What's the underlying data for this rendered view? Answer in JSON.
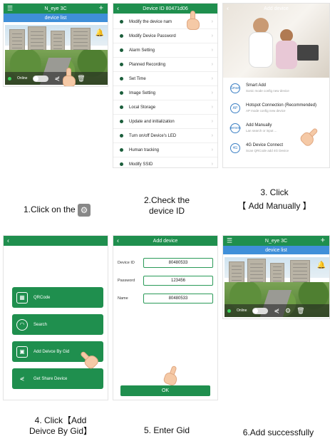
{
  "p1": {
    "title": "N_eye 3C",
    "subtitle": "device list",
    "status": "Online"
  },
  "p2": {
    "title": "Device ID 80471d06",
    "items": [
      "Modify the device nam",
      "Modify Device Password",
      "Alarm Setting",
      "Planned Recording",
      "Set Time",
      "Image Setting",
      "Local Storage",
      "Update and initialization",
      "Turn on/off Device's LED",
      "Human tracking",
      "Modify SSID"
    ]
  },
  "p3": {
    "title": "Add device",
    "options": [
      {
        "title": "Smart Add",
        "desc": "Sonic mode config new device",
        "icon": "Smart"
      },
      {
        "title": "Hotspot Connection (Recommended)",
        "desc": "AP mode config new device",
        "icon": "AP"
      },
      {
        "title": "Add Manually",
        "desc": "Lan search or input ...",
        "icon": "person"
      },
      {
        "title": "4G Device Connect",
        "desc": "Scan QRCode add 4G Device",
        "icon": "4G"
      }
    ]
  },
  "p4": {
    "buttons": [
      "QRCode",
      "Search",
      "Add Deivce By Gid",
      "Get Share Device"
    ]
  },
  "p5": {
    "title": "Add device",
    "fields": [
      {
        "label": "Device ID",
        "value": "80480533"
      },
      {
        "label": "Password",
        "value": "123456"
      },
      {
        "label": "Name",
        "value": "80480533"
      }
    ],
    "ok": "OK"
  },
  "p6": {
    "title": "N_eye 3C",
    "subtitle": "device list",
    "status": "Online"
  },
  "captions": {
    "c1": "1.Click on the",
    "c2a": "2.Check the",
    "c2b": "device ID",
    "c3a": "3. Click",
    "c3b": "【 Add Manually 】",
    "c4a": "4. Click【Add",
    "c4b": "Deivce By Gid】",
    "c5": "5. Enter Gid",
    "c6": "6.Add successfully"
  }
}
